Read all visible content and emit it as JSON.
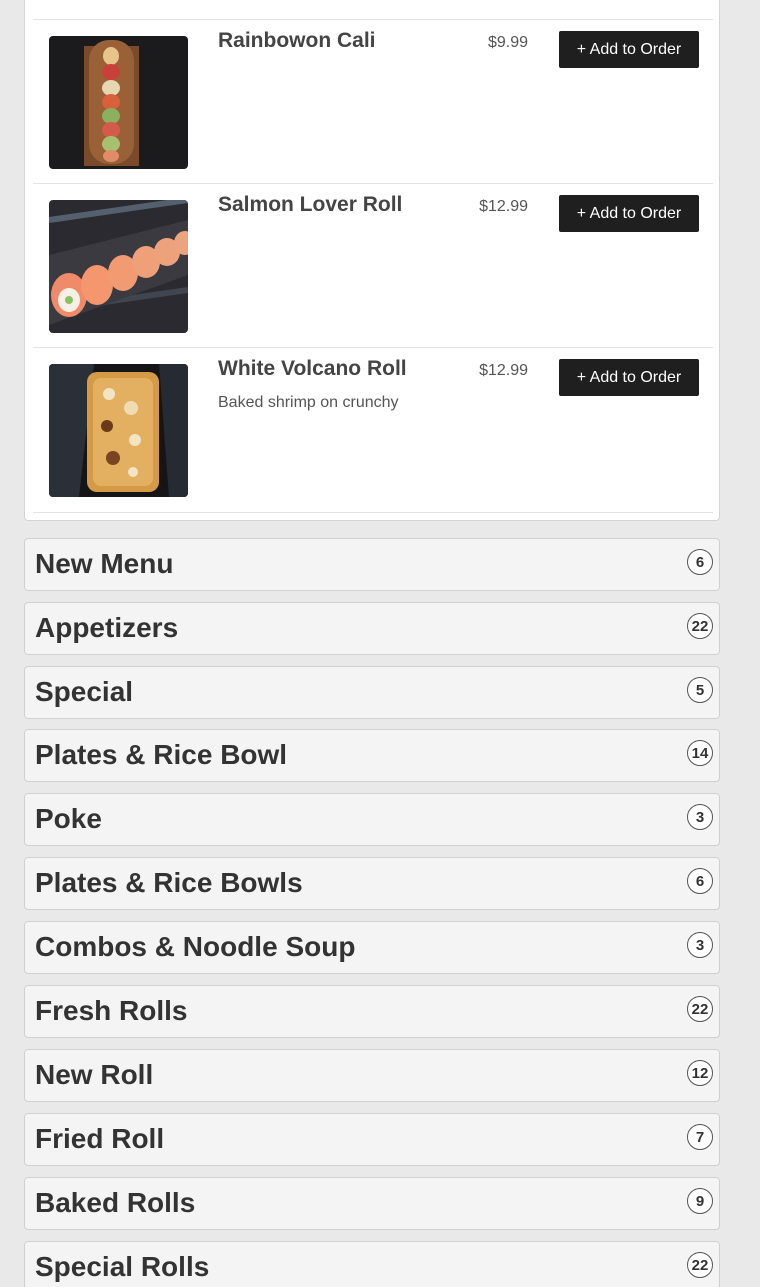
{
  "items": [
    {
      "name": "Rainbowon Cali",
      "description": "",
      "price": "$9.99",
      "button_label": "+ Add to Order",
      "image_icon": "sushi-roll-photo"
    },
    {
      "name": "Salmon Lover Roll",
      "description": "",
      "price": "$12.99",
      "button_label": "+ Add to Order",
      "image_icon": "sushi-roll-photo"
    },
    {
      "name": "White Volcano Roll",
      "description": "Baked shrimp on crunchy",
      "price": "$12.99",
      "button_label": "+ Add to Order",
      "image_icon": "sushi-roll-photo"
    }
  ],
  "categories": [
    {
      "title": "New Menu",
      "count": "6"
    },
    {
      "title": "Appetizers",
      "count": "22"
    },
    {
      "title": "Special",
      "count": "5"
    },
    {
      "title": "Plates & Rice Bowl",
      "count": "14"
    },
    {
      "title": "Poke",
      "count": "3"
    },
    {
      "title": "Plates & Rice Bowls",
      "count": "6"
    },
    {
      "title": "Combos & Noodle Soup",
      "count": "3"
    },
    {
      "title": "Fresh Rolls",
      "count": "22"
    },
    {
      "title": "New Roll",
      "count": "12"
    },
    {
      "title": "Fried Roll",
      "count": "7"
    },
    {
      "title": "Baked Rolls",
      "count": "9"
    },
    {
      "title": "Special Rolls",
      "count": "22"
    }
  ],
  "colors": {
    "button_bg": "#1f1f1f",
    "button_text": "#ffffff",
    "category_bg": "#f4f4f4",
    "page_bg": "#e9e9e9"
  }
}
